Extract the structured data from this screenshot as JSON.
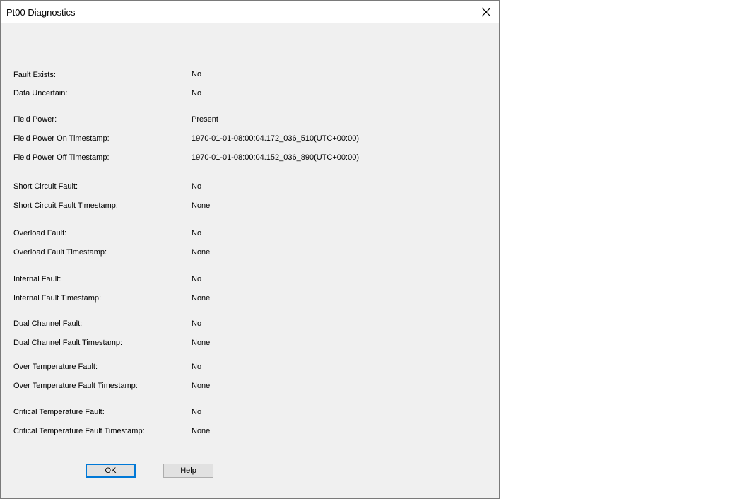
{
  "window": {
    "title": "Pt00 Diagnostics"
  },
  "fields": [
    {
      "label": "Fault Exists:",
      "value": "No"
    },
    {
      "label": "Data Uncertain:",
      "value": "No"
    },
    {
      "label": "Field Power:",
      "value": "Present"
    },
    {
      "label": "Field Power On Timestamp:",
      "value": "1970-01-01-08:00:04.172_036_510(UTC+00:00)"
    },
    {
      "label": "Field Power Off Timestamp:",
      "value": "1970-01-01-08:00:04.152_036_890(UTC+00:00)"
    },
    {
      "label": "Short Circuit Fault:",
      "value": "No"
    },
    {
      "label": "Short Circuit Fault Timestamp:",
      "value": "None"
    },
    {
      "label": "Overload Fault:",
      "value": "No"
    },
    {
      "label": "Overload Fault Timestamp:",
      "value": "None"
    },
    {
      "label": "Internal Fault:",
      "value": "No"
    },
    {
      "label": "Internal Fault Timestamp:",
      "value": "None"
    },
    {
      "label": "Dual Channel Fault:",
      "value": "No"
    },
    {
      "label": "Dual Channel Fault Timestamp:",
      "value": "None"
    },
    {
      "label": "Over Temperature Fault:",
      "value": "No"
    },
    {
      "label": "Over Temperature Fault Timestamp:",
      "value": "None"
    },
    {
      "label": "Critical Temperature Fault:",
      "value": "No"
    },
    {
      "label": "Critical Temperature Fault Timestamp:",
      "value": "None"
    }
  ],
  "buttons": {
    "ok_label": "OK",
    "help_label": "Help"
  },
  "icons": {
    "close": "close-icon"
  },
  "colors": {
    "dialog_bg": "#f0f0f0",
    "default_button_border": "#0078d7"
  }
}
